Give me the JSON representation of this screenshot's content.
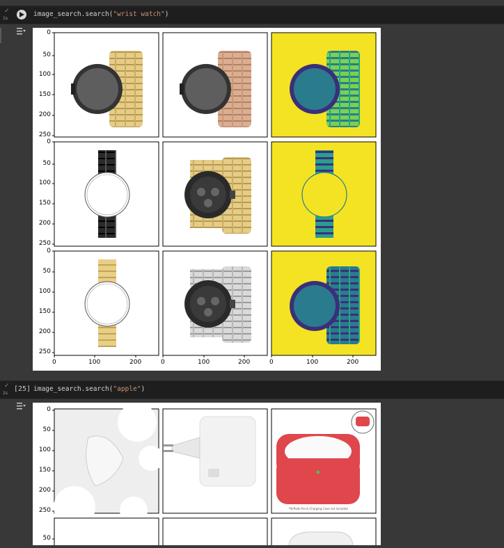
{
  "cells": [
    {
      "status": "✓",
      "time": "1s",
      "code_fn": "image_search.search(",
      "code_arg": "\"wrist watch\"",
      "code_close": ")",
      "execution_count": ""
    },
    {
      "status": "✓",
      "time": "2s",
      "code_fn": "image_search.search(",
      "code_arg": "\"apple\"",
      "code_close": ")",
      "execution_count": "[25]"
    }
  ],
  "figure1": {
    "y_ticks": [
      "0",
      "50",
      "100",
      "150",
      "200",
      "250"
    ],
    "x_ticks": [
      "0",
      "100",
      "200"
    ],
    "panels": [
      "gold-link-watch",
      "rose-gold-link-watch",
      "yellow-colormap-watch",
      "black-band-outline",
      "gold-chrono-watch",
      "yellow-colormap-outline",
      "gold-band-outline",
      "silver-chrono-watch",
      "yellow-colormap-watch-2"
    ]
  },
  "figure2": {
    "y_ticks": [
      "0",
      "50",
      "100",
      "150",
      "200",
      "250"
    ],
    "y_ticks_row2": [
      "50"
    ],
    "caption": "*AirPods Pro & Charging Case not included"
  },
  "colors": {
    "viridis_yellow": "#f4e323",
    "viridis_teal": "#2a7b8e",
    "viridis_navy": "#3b2f7a",
    "viridis_green": "#7ad151",
    "gold": "#e6cc84",
    "rose": "#d9a98a",
    "case_red": "#e0474c"
  }
}
